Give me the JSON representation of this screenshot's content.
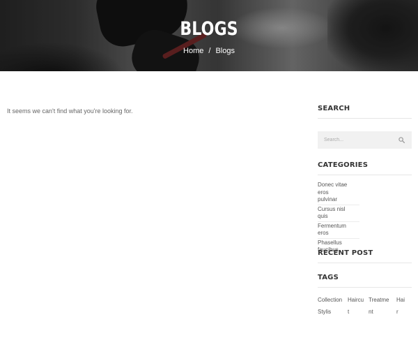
{
  "hero": {
    "title": "BLOGS",
    "breadcrumb": {
      "home": "Home",
      "separator": "/",
      "current": "Blogs"
    }
  },
  "main": {
    "notice": "It seems we can't find what you're looking for."
  },
  "sidebar": {
    "search": {
      "title": "SEARCH",
      "placeholder": "Search..."
    },
    "categories": {
      "title": "CATEGORIES",
      "items": [
        {
          "line1": "Donec vitae eros",
          "line2": "pulvinar"
        },
        {
          "line1": "Cursus nisl",
          "line2": "quis"
        },
        {
          "line1": "Fermentum",
          "line2": "eros"
        },
        {
          "line1": "Phasellus",
          "line2": "faucibus"
        }
      ]
    },
    "recent_post": {
      "title": "RECENT POST"
    },
    "tags": {
      "title": "TAGS",
      "items": [
        {
          "top": "Collection",
          "bottom": "Stylis"
        },
        {
          "top": "Haircu",
          "bottom": "t"
        },
        {
          "top": "Treatme",
          "bottom": "nt"
        },
        {
          "top": "Hai",
          "bottom": "r"
        }
      ]
    }
  }
}
